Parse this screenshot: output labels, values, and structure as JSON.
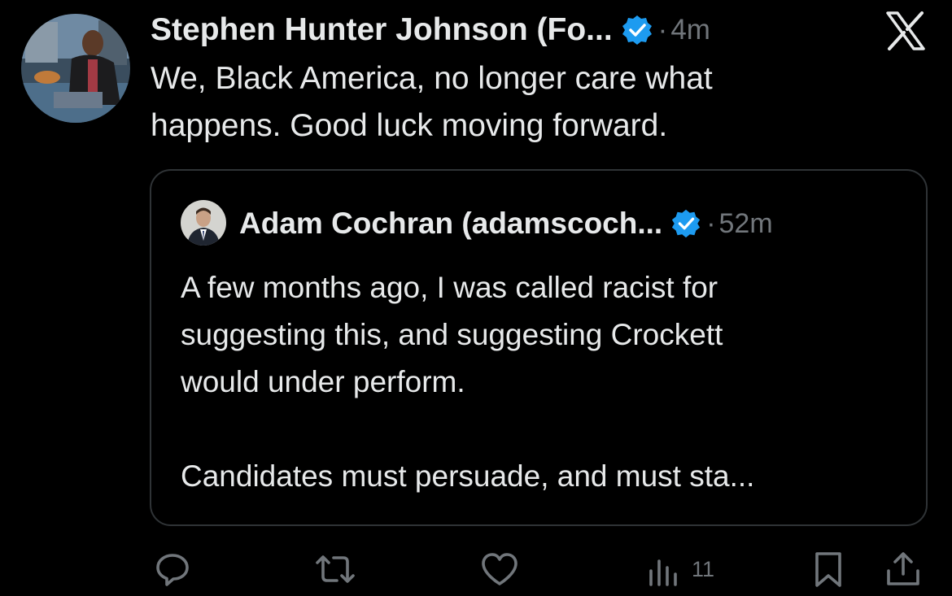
{
  "tweet": {
    "author_name": "Stephen Hunter Johnson (Fo...",
    "separator": "·",
    "time": "4m",
    "text": "We, Black America,  no longer care what\nhappens.  Good luck moving forward."
  },
  "quote": {
    "author_name": "Adam Cochran (adamscoch...",
    "separator": "·",
    "time": "52m",
    "text_1": "A few months ago, I was called racist for\nsuggesting this, and suggesting Crockett\nwould under perform.",
    "text_2": "Candidates must persuade, and must sta..."
  },
  "actions": {
    "views_count": "11"
  },
  "colors": {
    "background": "#000000",
    "text": "#e7e9ea",
    "muted": "#71767b",
    "verified": "#1d9bf0",
    "border": "#2f3336"
  },
  "icons": [
    "x-logo-icon",
    "verified-icon",
    "reply-icon",
    "retweet-icon",
    "like-icon",
    "views-icon",
    "bookmark-icon",
    "share-icon"
  ]
}
